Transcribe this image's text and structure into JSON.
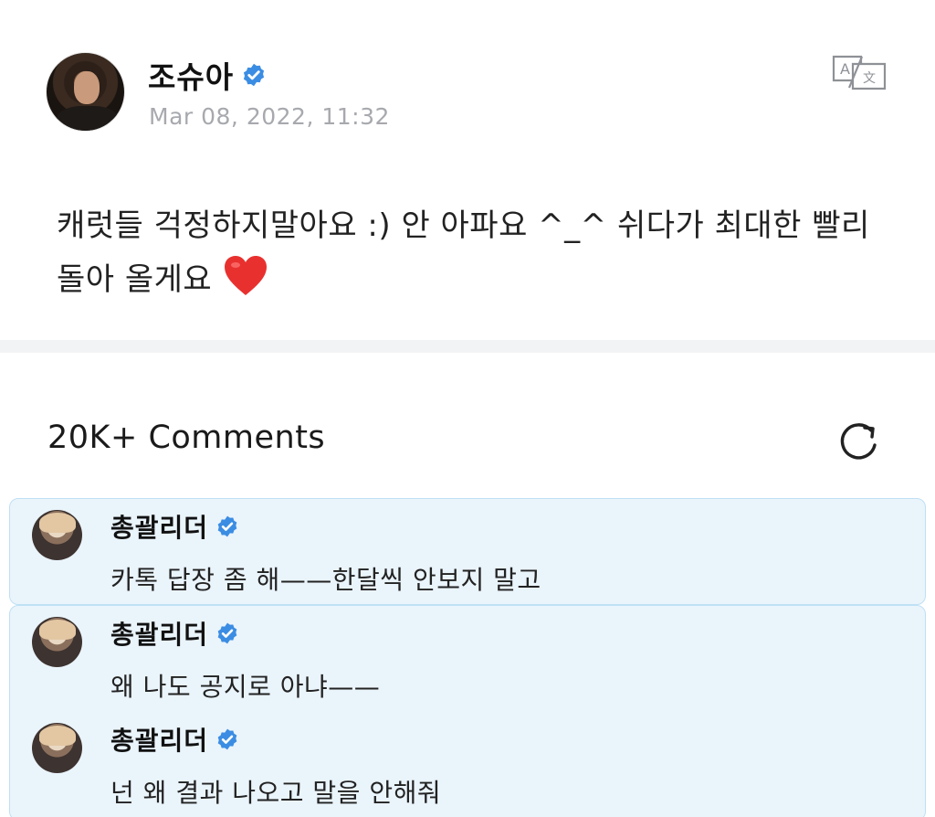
{
  "post": {
    "author": "조슈아",
    "date": "Mar 08, 2022, 11:32",
    "body": "캐럿들 걱정하지말아요 :) 안 아파요 ^_^ 쉬다가 최대한 빨리 돌아 올게요",
    "avatar_icon": "profile-photo",
    "verified_icon": "verified-badge-icon",
    "translate_icon": "translate-icon"
  },
  "comments_section": {
    "title": "20K+ Comments",
    "refresh_icon": "refresh-icon"
  },
  "comments": [
    {
      "author": "총괄리더",
      "text": "카톡 답장 좀 해——한달씩 안보지 말고"
    },
    {
      "author": "총괄리더",
      "text": "왜 나도 공지로 아냐——"
    },
    {
      "author": "총괄리더",
      "text": "넌 왜 결과 나오고 말을 안해줘"
    }
  ],
  "colors": {
    "verified_blue": "#3b8de3",
    "comment_bg": "#eaf4fb",
    "comment_border": "#bfe0f5",
    "date_gray": "#a7a9ae",
    "heart_red": "#e8312f"
  }
}
